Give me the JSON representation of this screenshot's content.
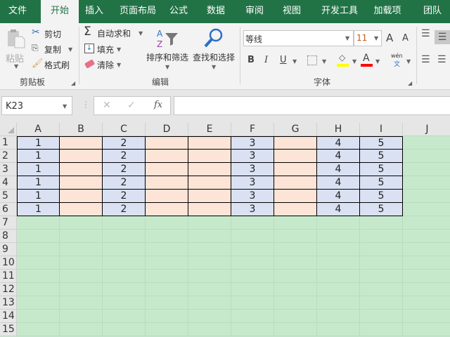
{
  "tabs": [
    "文件",
    "开始",
    "插入",
    "页面布局",
    "公式",
    "数据",
    "审阅",
    "视图",
    "开发工具",
    "加载项",
    "团队"
  ],
  "active_tab": "开始",
  "clipboard": {
    "paste": "粘贴",
    "cut": "剪切",
    "copy": "复制",
    "format_painter": "格式刷",
    "group": "剪贴板"
  },
  "editing": {
    "autosum": "自动求和",
    "fill": "填充",
    "clear": "清除",
    "sort_filter": "排序和筛选",
    "find_select": "查找和选择",
    "group": "编辑"
  },
  "font": {
    "name": "等线",
    "size": "11",
    "bold": "B",
    "italic": "I",
    "underline": "U",
    "font_color_glyph": "A",
    "phonetic_top": "wén",
    "phonetic_bottom": "文",
    "grow": "A",
    "shrink": "A",
    "group": "字体"
  },
  "colors": {
    "fill": "#ffff00",
    "font": "#ff0000",
    "accent": "#217346"
  },
  "formula_bar": {
    "name_box": "K23",
    "cancel": "✕",
    "enter": "✓",
    "fx": "fx",
    "formula": ""
  },
  "sheet": {
    "columns": [
      "A",
      "B",
      "C",
      "D",
      "E",
      "F",
      "G",
      "H",
      "I",
      "J"
    ],
    "rows": [
      "1",
      "2",
      "3",
      "4",
      "5",
      "6",
      "7",
      "8",
      "9",
      "10",
      "11",
      "12",
      "13",
      "14",
      "15"
    ],
    "column_fill": [
      "blue",
      "peach",
      "blue",
      "peach",
      "peach",
      "blue",
      "peach",
      "blue",
      "blue",
      "none"
    ],
    "data": [
      [
        "1",
        "",
        "2",
        "",
        "",
        "3",
        "",
        "4",
        "5",
        ""
      ],
      [
        "1",
        "",
        "2",
        "",
        "",
        "3",
        "",
        "4",
        "5",
        ""
      ],
      [
        "1",
        "",
        "2",
        "",
        "",
        "3",
        "",
        "4",
        "5",
        ""
      ],
      [
        "1",
        "",
        "2",
        "",
        "",
        "3",
        "",
        "4",
        "5",
        ""
      ],
      [
        "1",
        "",
        "2",
        "",
        "",
        "3",
        "",
        "4",
        "5",
        ""
      ],
      [
        "1",
        "",
        "2",
        "",
        "",
        "3",
        "",
        "4",
        "5",
        ""
      ]
    ]
  }
}
